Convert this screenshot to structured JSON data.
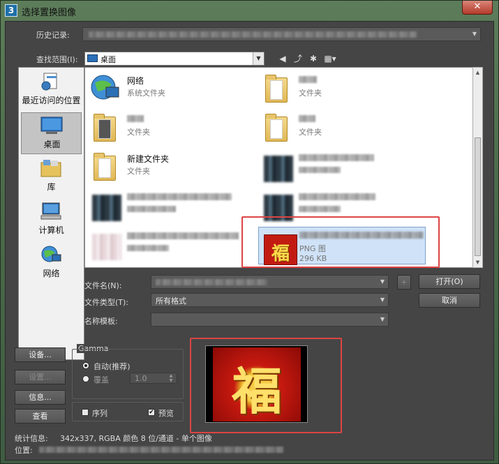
{
  "window": {
    "title": "选择置换图像",
    "app_icon_text": "3",
    "close_glyph": "✕"
  },
  "history": {
    "label": "历史记录:"
  },
  "look_in": {
    "label": "查找范围(I):",
    "value": "桌面"
  },
  "places": [
    {
      "label": "最近访问的位置",
      "icon": "recent-places-icon"
    },
    {
      "label": "桌面",
      "icon": "desktop-icon"
    },
    {
      "label": "库",
      "icon": "library-icon"
    },
    {
      "label": "计算机",
      "icon": "computer-icon"
    },
    {
      "label": "网络",
      "icon": "network-icon"
    }
  ],
  "files": [
    {
      "name": "网络",
      "type": "系统文件夹"
    },
    {
      "name": "",
      "type": "文件夹"
    },
    {
      "name": "",
      "type": "文件夹"
    },
    {
      "name": "",
      "type": "文件夹"
    },
    {
      "name": "新建文件夹",
      "type": "文件夹"
    },
    {
      "name": "",
      "type": ""
    },
    {
      "name": "",
      "type": ""
    },
    {
      "name": "",
      "type": ""
    },
    {
      "name": "",
      "type": ""
    },
    {
      "name": "",
      "type": "PNG 图",
      "size": "296 KB"
    }
  ],
  "filename": {
    "label": "文件名(N):"
  },
  "filetype": {
    "label": "文件类型(T):",
    "value": "所有格式"
  },
  "name_template": {
    "label": "名称模板:"
  },
  "buttons": {
    "plus": "+",
    "open": "打开(O)",
    "cancel": "取消",
    "setup": "设备...",
    "settings": "设置...",
    "info": "信息...",
    "view": "查看"
  },
  "gamma": {
    "title": "Gamma",
    "auto": "自动(推荐)",
    "override": "覆盖",
    "override_value": "1.0"
  },
  "options": {
    "sequence": "序列",
    "preview": "预览",
    "preview_checked": "✔"
  },
  "preview_glyph": "福",
  "status": {
    "stats_label": "统计信息:",
    "stats_value": "342x337, RGBA 颜色 8 位/通道 - 单个图像",
    "location_label": "位置:"
  },
  "colors": {
    "highlight": "#d44444",
    "selection": "#cfe2f7"
  }
}
